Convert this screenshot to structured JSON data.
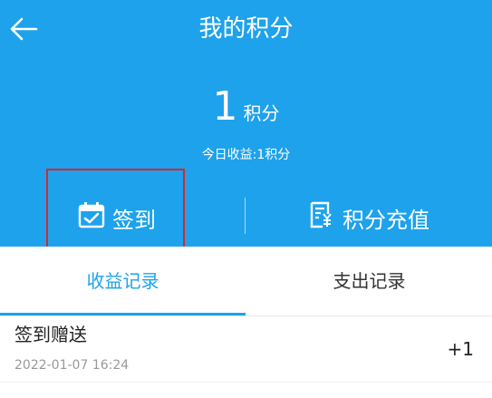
{
  "header": {
    "title": "我的积分",
    "points_value": "1",
    "points_unit": "积分",
    "today_income": "今日收益:1积分",
    "background": "#1ea2eb"
  },
  "actions": {
    "signin_label": "签到",
    "signin_icon": "calendar-check-icon",
    "recharge_label": "积分充值",
    "recharge_icon": "yen-receipt-icon"
  },
  "tabs": [
    {
      "label": "收益记录",
      "active": true
    },
    {
      "label": "支出记录",
      "active": false
    }
  ],
  "records": [
    {
      "title": "签到赠送",
      "time": "2022-01-07 16:24",
      "amount": "+1"
    }
  ]
}
